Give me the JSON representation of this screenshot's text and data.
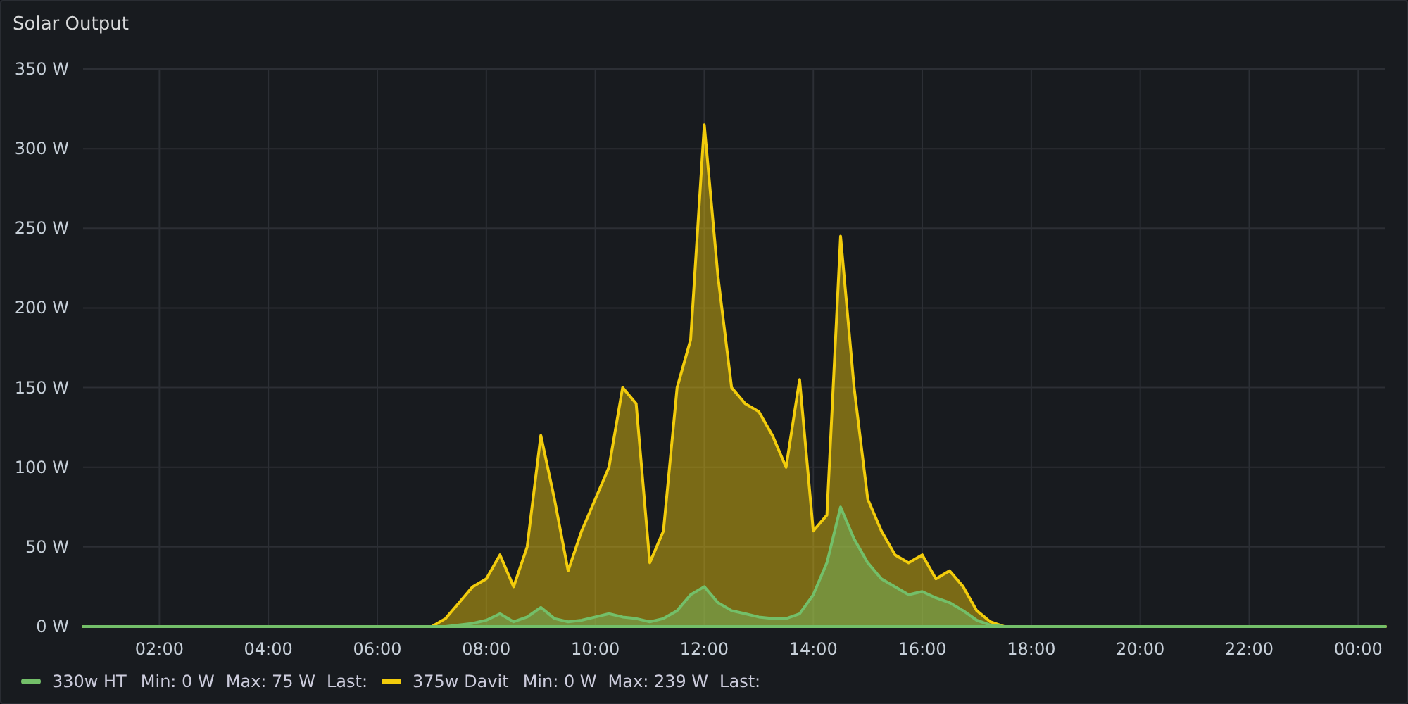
{
  "panel": {
    "title": "Solar Output"
  },
  "chart_data": {
    "type": "area",
    "x": [
      0.6,
      7.0,
      7.25,
      7.5,
      7.75,
      8.0,
      8.25,
      8.5,
      8.75,
      9.0,
      9.25,
      9.5,
      9.75,
      10.0,
      10.25,
      10.5,
      10.75,
      11.0,
      11.25,
      11.5,
      11.75,
      12.0,
      12.25,
      12.5,
      12.75,
      13.0,
      13.25,
      13.5,
      13.75,
      14.0,
      14.25,
      14.5,
      14.75,
      15.0,
      15.25,
      15.5,
      15.75,
      16.0,
      16.25,
      16.5,
      16.75,
      17.0,
      17.25,
      17.5,
      24.5
    ],
    "series": [
      {
        "name": "330w HT",
        "color": "#73bf69",
        "values": [
          0,
          0,
          0,
          1,
          2,
          4,
          8,
          3,
          6,
          12,
          5,
          3,
          4,
          6,
          8,
          6,
          5,
          3,
          5,
          10,
          20,
          25,
          15,
          10,
          8,
          6,
          5,
          5,
          8,
          20,
          40,
          75,
          55,
          40,
          30,
          25,
          20,
          22,
          18,
          15,
          10,
          4,
          1,
          0,
          0
        ]
      },
      {
        "name": "375w Davit",
        "color": "#f2cc0c",
        "values": [
          0,
          0,
          5,
          15,
          25,
          30,
          45,
          25,
          50,
          120,
          80,
          35,
          60,
          80,
          100,
          150,
          140,
          40,
          60,
          150,
          180,
          315,
          220,
          150,
          140,
          135,
          120,
          100,
          155,
          60,
          70,
          245,
          150,
          80,
          60,
          45,
          40,
          45,
          30,
          35,
          25,
          10,
          3,
          0,
          0
        ]
      }
    ],
    "grid": true,
    "xlim": [
      0.6,
      24.5
    ],
    "ylim": [
      0,
      350
    ],
    "xticks": [
      {
        "value": 2,
        "label": "02:00"
      },
      {
        "value": 4,
        "label": "04:00"
      },
      {
        "value": 6,
        "label": "06:00"
      },
      {
        "value": 8,
        "label": "08:00"
      },
      {
        "value": 10,
        "label": "10:00"
      },
      {
        "value": 12,
        "label": "12:00"
      },
      {
        "value": 14,
        "label": "14:00"
      },
      {
        "value": 16,
        "label": "16:00"
      },
      {
        "value": 18,
        "label": "18:00"
      },
      {
        "value": 20,
        "label": "20:00"
      },
      {
        "value": 22,
        "label": "22:00"
      },
      {
        "value": 24,
        "label": "00:00"
      }
    ],
    "yticks": [
      {
        "value": 0,
        "label": "0 W"
      },
      {
        "value": 50,
        "label": "50 W"
      },
      {
        "value": 100,
        "label": "100 W"
      },
      {
        "value": 150,
        "label": "150 W"
      },
      {
        "value": 200,
        "label": "200 W"
      },
      {
        "value": 250,
        "label": "250 W"
      },
      {
        "value": 300,
        "label": "300 W"
      },
      {
        "value": 350,
        "label": "350 W"
      }
    ]
  },
  "legend": [
    {
      "min": "Min: 0 W",
      "max": "Max: 75 W",
      "last": "Last:"
    },
    {
      "min": "Min: 0 W",
      "max": "Max: 239 W",
      "last": "Last:"
    }
  ]
}
